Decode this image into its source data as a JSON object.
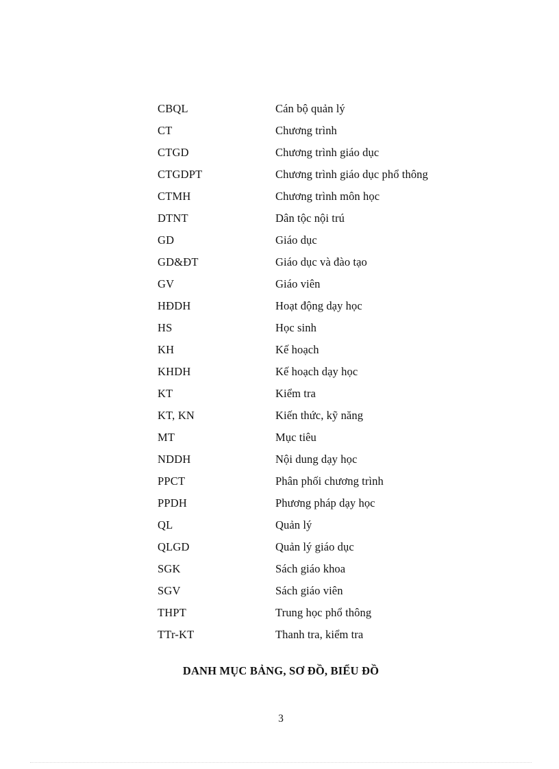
{
  "document": {
    "background_color": "#ffffff",
    "text_color": "#111111"
  },
  "abbreviations": {
    "rows": [
      {
        "term": "CBQL",
        "definition": "Cán bộ quản lý"
      },
      {
        "term": "CT",
        "definition": "Chương trình"
      },
      {
        "term": "CTGD",
        "definition": "Chương trình giáo  dục"
      },
      {
        "term": "CTGDPT",
        "definition": "Chương trình giáo  dục  phổ thông"
      },
      {
        "term": "CTMH",
        "definition": "Chương trình môn học"
      },
      {
        "term": "DTNT",
        "definition": "Dân tộc nội trú"
      },
      {
        "term": "GD",
        "definition": "Giáo dục"
      },
      {
        "term": "GD&ĐT",
        "definition": "Giáo dục và đào tạo"
      },
      {
        "term": "GV",
        "definition": "Giáo viên"
      },
      {
        "term": "HĐDH",
        "definition": "Hoạt động dạy học"
      },
      {
        "term": "HS",
        "definition": "Học sinh"
      },
      {
        "term": "KH",
        "definition": "Kế hoạch"
      },
      {
        "term": "KHDH",
        "definition": "Kế hoạch dạy học"
      },
      {
        "term": "KT",
        "definition": "Kiểm  tra"
      },
      {
        "term": "KT, KN",
        "definition": "Kiến thức, kỹ năng"
      },
      {
        "term": "MT",
        "definition": "Mục tiêu"
      },
      {
        "term": "NDDH",
        "definition": "Nội dung dạy học"
      },
      {
        "term": "PPCT",
        "definition": "Phân phối chương trình"
      },
      {
        "term": "PPDH",
        "definition": "Phương pháp dạy học"
      },
      {
        "term": "QL",
        "definition": "Quản lý"
      },
      {
        "term": "QLGD",
        "definition": "Quản lý giáo dục"
      },
      {
        "term": "SGK",
        "definition": "Sách giáo khoa"
      },
      {
        "term": "SGV",
        "definition": "Sách giáo viên"
      },
      {
        "term": "THPT",
        "definition": "Trung học phổ thông"
      },
      {
        "term": "TTr-KT",
        "definition": "Thanh tra, kiểm  tra"
      }
    ]
  },
  "section_heading": {
    "text": "DANH MỤC BẢNG, SƠ ĐỒ, BIỂU ĐỒ"
  },
  "footer": {
    "page_number": "3"
  }
}
